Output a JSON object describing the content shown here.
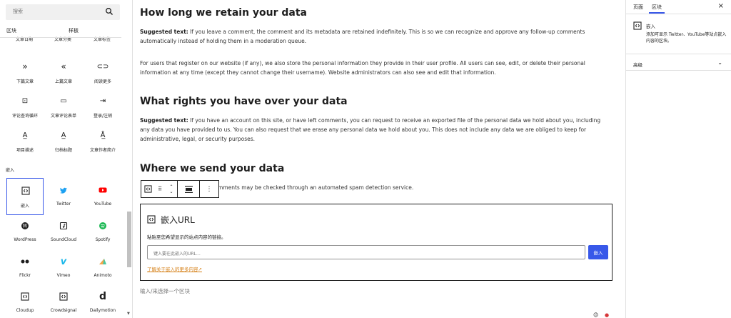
{
  "inserter": {
    "search_placeholder": "搜索",
    "tabs": [
      "区块",
      "样板"
    ],
    "cut_row": [
      "文章日期",
      "文章分类",
      "文章标签"
    ],
    "theme_blocks": [
      {
        "label": "下篇文章",
        "icon": "next-post-icon"
      },
      {
        "label": "上篇文章",
        "icon": "previous-post-icon"
      },
      {
        "label": "阅读更多",
        "icon": "read-more-icon"
      },
      {
        "label": "评论查询循环",
        "icon": "comments-query-loop-icon"
      },
      {
        "label": "文章评论表单",
        "icon": "post-comments-form-icon"
      },
      {
        "label": "登录/注销",
        "icon": "login-logout-icon"
      },
      {
        "label": "项目描述",
        "icon": "term-description-icon"
      },
      {
        "label": "归档标题",
        "icon": "archive-title-icon"
      },
      {
        "label": "文章作者简介",
        "icon": "post-author-bio-icon"
      }
    ],
    "embed_category": "嵌入",
    "embed_blocks": [
      {
        "label": "嵌入",
        "icon": "embed-icon",
        "color": "#1e1e1e"
      },
      {
        "label": "Twitter",
        "icon": "twitter-icon",
        "color": "#1da1f2"
      },
      {
        "label": "YouTube",
        "icon": "youtube-icon",
        "color": "#ff0000"
      },
      {
        "label": "WordPress",
        "icon": "wordpress-icon",
        "color": "#1e1e1e"
      },
      {
        "label": "SoundCloud",
        "icon": "soundcloud-icon",
        "color": "#1e1e1e"
      },
      {
        "label": "Spotify",
        "icon": "spotify-icon",
        "color": "#1db954"
      },
      {
        "label": "Flickr",
        "icon": "flickr-icon",
        "color": "#1e1e1e"
      },
      {
        "label": "Vimeo",
        "icon": "vimeo-icon",
        "color": "#1ab7ea"
      },
      {
        "label": "Animoto",
        "icon": "animoto-icon",
        "color": "#4bc7a2"
      },
      {
        "label": "Cloudup",
        "icon": "cloudup-icon",
        "color": "#1e1e1e"
      },
      {
        "label": "Crowdsignal",
        "icon": "crowdsignal-icon",
        "color": "#1e1e1e"
      },
      {
        "label": "Dailymotion",
        "icon": "dailymotion-icon",
        "color": "#1e1e1e"
      }
    ]
  },
  "content": {
    "retain_heading": "How long we retain your data",
    "retain_p1_label": "Suggested text:",
    "retain_p1": " If you leave a comment, the comment and its metadata are retained indefinitely. This is so we can recognize and approve any follow-up comments automatically instead of holding them in a moderation queue.",
    "retain_p2": "For users that register on our website (if any), we also store the personal information they provide in their user profile. All users can see, edit, or delete their personal information at any time (except they cannot change their username). Website administrators can also see and edit that information.",
    "rights_heading": "What rights you have over your data",
    "rights_p_label": "Suggested text:",
    "rights_p": " If you have an account on this site, or have left comments, you can request to receive an exported file of the personal data we hold about you, including any data you have provided to us. You can also request that we erase any personal data we hold about you. This does not include any data we are obliged to keep for administrative, legal, or security purposes.",
    "send_heading": "Where we send your data",
    "send_p_visible": "mments may be checked through an automated spam detection service."
  },
  "embed": {
    "title": "嵌入URL",
    "help": "粘贴至您希望显示的站点内容的链接。",
    "input_placeholder": "键入要在此嵌入的URL…",
    "button_label": "嵌入",
    "learn_more": "了解关于嵌入的更多内容",
    "next_hint": "输入/来选择一个区块"
  },
  "settings": {
    "tabs": [
      "页面",
      "区块"
    ],
    "close_label": "×",
    "block_name": "嵌入",
    "block_desc": "添加可显示 Twitter、YouTube等站点嵌入内容的区块。",
    "advanced": "高级"
  }
}
